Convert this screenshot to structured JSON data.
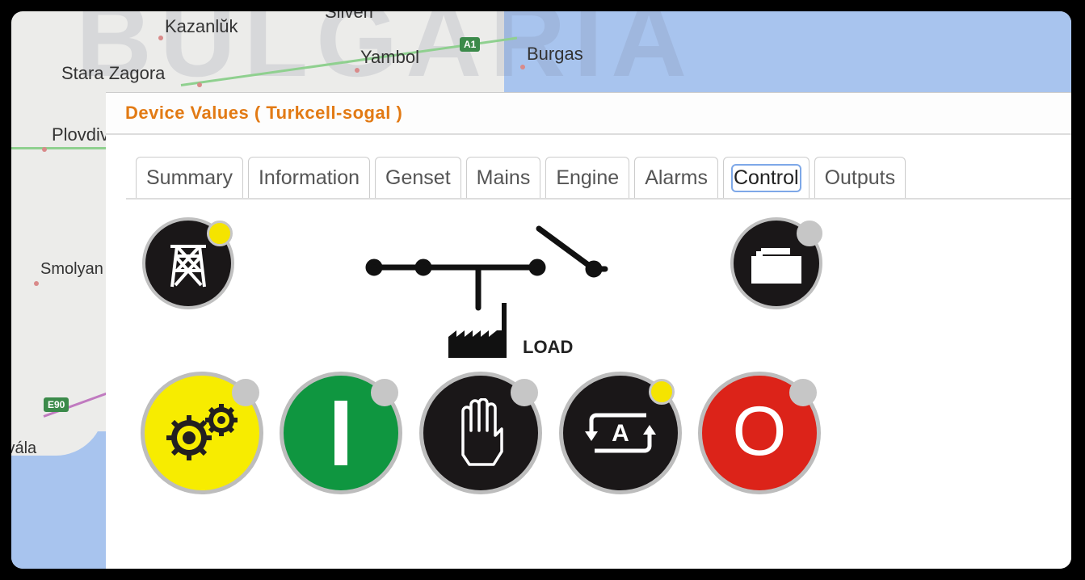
{
  "map": {
    "cities": [
      "Kazanlŭk",
      "Sliven",
      "Yambol",
      "Burgas",
      "Stara Zagora",
      "Plovdiv",
      "Smolyan",
      "Kavála"
    ],
    "road_shields": [
      "A1",
      "E90"
    ],
    "watermark": "BULGARIA"
  },
  "dialog": {
    "title": "Device Values ( Turkcell-sogal )"
  },
  "tabs": [
    {
      "label": "Summary",
      "active": false
    },
    {
      "label": "Information",
      "active": false
    },
    {
      "label": "Genset",
      "active": false
    },
    {
      "label": "Mains",
      "active": false
    },
    {
      "label": "Engine",
      "active": false
    },
    {
      "label": "Alarms",
      "active": false
    },
    {
      "label": "Control",
      "active": true
    },
    {
      "label": "Outputs",
      "active": false
    }
  ],
  "diagram": {
    "load_label": "LOAD",
    "mains_indicator": {
      "icon": "power-pylon-icon",
      "led": "on",
      "led_color": "#f5e400"
    },
    "generator_indicator": {
      "icon": "generator-icon",
      "led": "off",
      "led_color": "#c6c6c6"
    }
  },
  "control_buttons": [
    {
      "name": "run-button",
      "icon": "gears-icon",
      "bg": "#f7ec00",
      "led": "off",
      "led_color": "#c6c6c6"
    },
    {
      "name": "start-button",
      "icon": "start-i-icon",
      "bg": "#0f9640",
      "led": "off",
      "led_color": "#c6c6c6"
    },
    {
      "name": "manual-button",
      "icon": "hand-icon",
      "bg": "#1a1718",
      "led": "off",
      "led_color": "#c6c6c6"
    },
    {
      "name": "auto-button",
      "icon": "auto-a-icon",
      "label": "A",
      "bg": "#1a1718",
      "led": "on",
      "led_color": "#f5e400"
    },
    {
      "name": "stop-button",
      "icon": "stop-o-icon",
      "label": "O",
      "bg": "#dc2319",
      "led": "off",
      "led_color": "#c6c6c6"
    }
  ]
}
